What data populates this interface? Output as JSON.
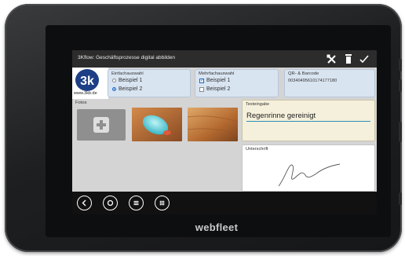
{
  "app": {
    "title": "3Kflow: Geschäftsprozesse digital abbilden",
    "toolbar_icons": [
      "tools-icon",
      "trash-icon",
      "checkmark-icon"
    ]
  },
  "logo": {
    "mark": "3kb",
    "url": "www.3kb.de"
  },
  "einfachauswahl": {
    "title": "Einfachauswahl",
    "options": [
      {
        "label": "Beispiel 1",
        "selected": false
      },
      {
        "label": "Beispiel 2",
        "selected": true
      }
    ]
  },
  "mehrfachauswahl": {
    "title": "Mehrfachauswahl",
    "options": [
      {
        "label": "Beispiel 1",
        "checked": true
      },
      {
        "label": "Beispiel 2",
        "checked": false
      }
    ]
  },
  "qr": {
    "title": "QR- & Barcode",
    "value": "00340495610174177180"
  },
  "fotos": {
    "label": "Fotos",
    "photos": [
      "photo-mouse",
      "photo-wood"
    ]
  },
  "texteingabe": {
    "label": "Texteingabe",
    "value": "Regenrinne gereinigt"
  },
  "unterschrift": {
    "label": "Unterschrift"
  },
  "navbar": {
    "icons": [
      "back-icon",
      "home-icon",
      "menu-icon",
      "apps-icon"
    ]
  },
  "device": {
    "brand": "webfleet"
  },
  "colors": {
    "panel_blue": "#d9e4f1",
    "text_panel": "#f5f0dc",
    "titlebar": "#2c2c2c",
    "accent": "#1a66c4"
  }
}
